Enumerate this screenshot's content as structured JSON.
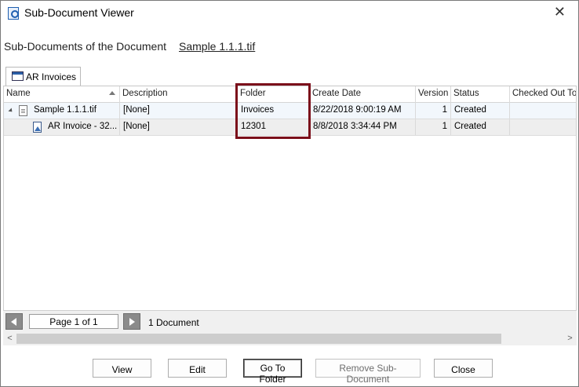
{
  "window": {
    "title": "Sub-Document Viewer"
  },
  "header": {
    "label": "Sub-Documents of the Document",
    "document_link": "Sample 1.1.1.tif"
  },
  "tabs": [
    {
      "label": "AR Invoices",
      "icon": "window-icon"
    }
  ],
  "grid": {
    "columns": [
      "Name",
      "Description",
      "Folder",
      "Create Date",
      "Version",
      "Status",
      "Checked Out To"
    ],
    "sort": {
      "column": "Name",
      "direction": "ascending"
    },
    "rows": [
      {
        "name": "Sample 1.1.1.tif",
        "description": "[None]",
        "folder": "Invoices",
        "create_date": "8/22/2018 9:00:19 AM",
        "version": "1",
        "status": "Created",
        "checked_out_to": "",
        "icon": "document-icon",
        "expanded": true
      },
      {
        "name": "AR Invoice - 32...",
        "description": "[None]",
        "folder": "12301",
        "create_date": "8/8/2018 3:34:44 PM",
        "version": "1",
        "status": "Created",
        "checked_out_to": "",
        "icon": "image-document-icon"
      }
    ]
  },
  "pager": {
    "page_label": "Page 1 of 1",
    "count_label": "1 Document"
  },
  "buttons": {
    "view": "View",
    "edit": "Edit",
    "go_to_folder": "Go To Folder",
    "remove_sub_document": "Remove Sub-Document",
    "close": "Close"
  },
  "colors": {
    "highlight": "#7b0e1a",
    "row_selected": "#f2f7fc"
  }
}
